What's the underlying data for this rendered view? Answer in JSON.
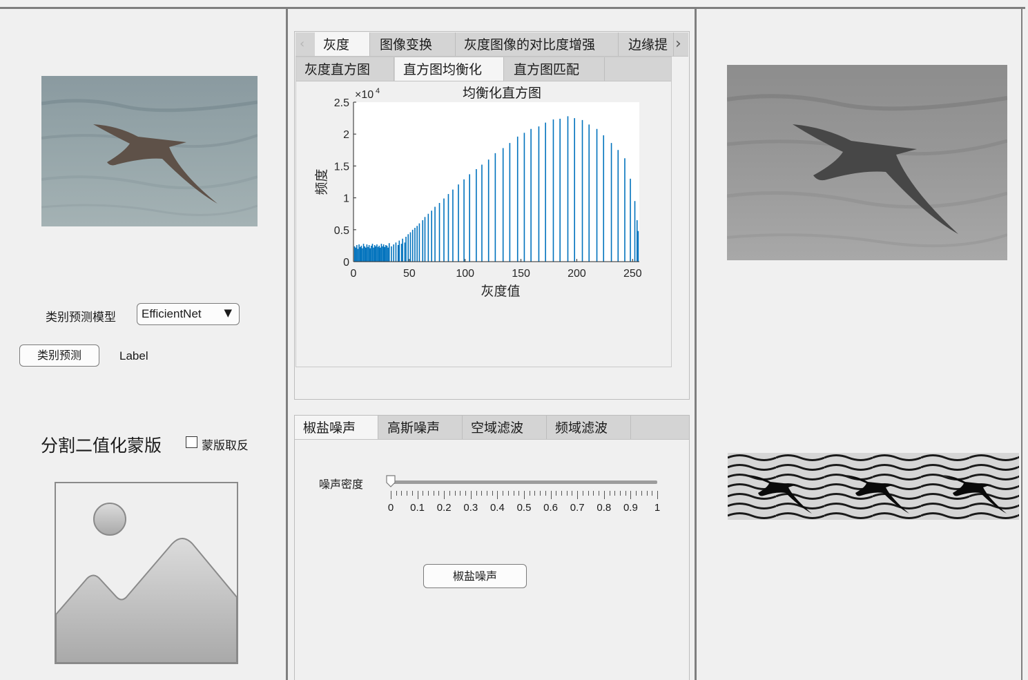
{
  "left": {
    "model_label": "类别预测模型",
    "model_select_value": "EfficientNet",
    "predict_button": "类别预测",
    "prediction_label": "Label",
    "mask_title": "分割二值化蒙版",
    "mask_invert_label": "蒙版取反",
    "mask_invert_checked": false
  },
  "top_tabs": [
    "灰度",
    "图像变换",
    "灰度图像的对比度增强",
    "边缘提"
  ],
  "sub_tabs": [
    "灰度直方图",
    "直方图均衡化",
    "直方图匹配"
  ],
  "bottom_tabs": [
    "椒盐噪声",
    "高斯噪声",
    "空域滤波",
    "频域滤波"
  ],
  "noise": {
    "density_label": "噪声密度",
    "density_value": 0,
    "slider_labels": [
      "0",
      "0.1",
      "0.2",
      "0.3",
      "0.4",
      "0.5",
      "0.6",
      "0.7",
      "0.8",
      "0.9",
      "1"
    ],
    "apply_button": "椒盐噪声"
  },
  "chart_data": {
    "type": "bar",
    "title": "均衡化直方图",
    "xlabel": "灰度值",
    "ylabel": "频度",
    "y_multiplier": "×10",
    "y_exponent": "4",
    "xlim": [
      0,
      256
    ],
    "ylim": [
      0,
      2.5
    ],
    "x_ticks": [
      "0",
      "50",
      "100",
      "150",
      "200",
      "250"
    ],
    "y_ticks": [
      "0",
      "0.5",
      "1",
      "1.5",
      "2",
      "2.5"
    ],
    "color": "#0072bd",
    "bars": [
      {
        "x": 1,
        "y": 0.24
      },
      {
        "x": 2,
        "y": 0.22
      },
      {
        "x": 3,
        "y": 0.26
      },
      {
        "x": 4,
        "y": 0.2
      },
      {
        "x": 5,
        "y": 0.27
      },
      {
        "x": 6,
        "y": 0.23
      },
      {
        "x": 7,
        "y": 0.25
      },
      {
        "x": 8,
        "y": 0.21
      },
      {
        "x": 9,
        "y": 0.28
      },
      {
        "x": 10,
        "y": 0.24
      },
      {
        "x": 11,
        "y": 0.22
      },
      {
        "x": 12,
        "y": 0.27
      },
      {
        "x": 13,
        "y": 0.23
      },
      {
        "x": 14,
        "y": 0.26
      },
      {
        "x": 15,
        "y": 0.21
      },
      {
        "x": 16,
        "y": 0.25
      },
      {
        "x": 17,
        "y": 0.28
      },
      {
        "x": 18,
        "y": 0.22
      },
      {
        "x": 19,
        "y": 0.26
      },
      {
        "x": 20,
        "y": 0.24
      },
      {
        "x": 21,
        "y": 0.27
      },
      {
        "x": 22,
        "y": 0.23
      },
      {
        "x": 23,
        "y": 0.25
      },
      {
        "x": 24,
        "y": 0.22
      },
      {
        "x": 25,
        "y": 0.28
      },
      {
        "x": 26,
        "y": 0.24
      },
      {
        "x": 27,
        "y": 0.27
      },
      {
        "x": 28,
        "y": 0.23
      },
      {
        "x": 29,
        "y": 0.26
      },
      {
        "x": 30,
        "y": 0.25
      },
      {
        "x": 31,
        "y": 0.22
      },
      {
        "x": 32,
        "y": 0.29
      },
      {
        "x": 34,
        "y": 0.24
      },
      {
        "x": 36,
        "y": 0.27
      },
      {
        "x": 38,
        "y": 0.3
      },
      {
        "x": 40,
        "y": 0.26
      },
      {
        "x": 41,
        "y": 0.33
      },
      {
        "x": 43,
        "y": 0.28
      },
      {
        "x": 44,
        "y": 0.36
      },
      {
        "x": 46,
        "y": 0.3
      },
      {
        "x": 47,
        "y": 0.39
      },
      {
        "x": 49,
        "y": 0.43
      },
      {
        "x": 51,
        "y": 0.46
      },
      {
        "x": 53,
        "y": 0.5
      },
      {
        "x": 55,
        "y": 0.53
      },
      {
        "x": 57,
        "y": 0.56
      },
      {
        "x": 59,
        "y": 0.6
      },
      {
        "x": 62,
        "y": 0.65
      },
      {
        "x": 64,
        "y": 0.7
      },
      {
        "x": 67,
        "y": 0.75
      },
      {
        "x": 70,
        "y": 0.8
      },
      {
        "x": 73,
        "y": 0.86
      },
      {
        "x": 77,
        "y": 0.92
      },
      {
        "x": 81,
        "y": 0.99
      },
      {
        "x": 85,
        "y": 1.06
      },
      {
        "x": 89,
        "y": 1.13
      },
      {
        "x": 94,
        "y": 1.21
      },
      {
        "x": 99,
        "y": 1.29
      },
      {
        "x": 104,
        "y": 1.37
      },
      {
        "x": 110,
        "y": 1.45
      },
      {
        "x": 115,
        "y": 1.52
      },
      {
        "x": 121,
        "y": 1.6
      },
      {
        "x": 127,
        "y": 1.7
      },
      {
        "x": 134,
        "y": 1.78
      },
      {
        "x": 140,
        "y": 1.86
      },
      {
        "x": 147,
        "y": 1.96
      },
      {
        "x": 153,
        "y": 2.02
      },
      {
        "x": 159,
        "y": 2.08
      },
      {
        "x": 166,
        "y": 2.12
      },
      {
        "x": 172,
        "y": 2.18
      },
      {
        "x": 179,
        "y": 2.23
      },
      {
        "x": 185,
        "y": 2.24
      },
      {
        "x": 192,
        "y": 2.28
      },
      {
        "x": 198,
        "y": 2.25
      },
      {
        "x": 205,
        "y": 2.22
      },
      {
        "x": 211,
        "y": 2.15
      },
      {
        "x": 218,
        "y": 2.08
      },
      {
        "x": 224,
        "y": 1.98
      },
      {
        "x": 231,
        "y": 1.86
      },
      {
        "x": 237,
        "y": 1.75
      },
      {
        "x": 243,
        "y": 1.62
      },
      {
        "x": 248,
        "y": 1.3
      },
      {
        "x": 252,
        "y": 0.95
      },
      {
        "x": 254,
        "y": 0.65
      },
      {
        "x": 255,
        "y": 0.48
      }
    ]
  }
}
